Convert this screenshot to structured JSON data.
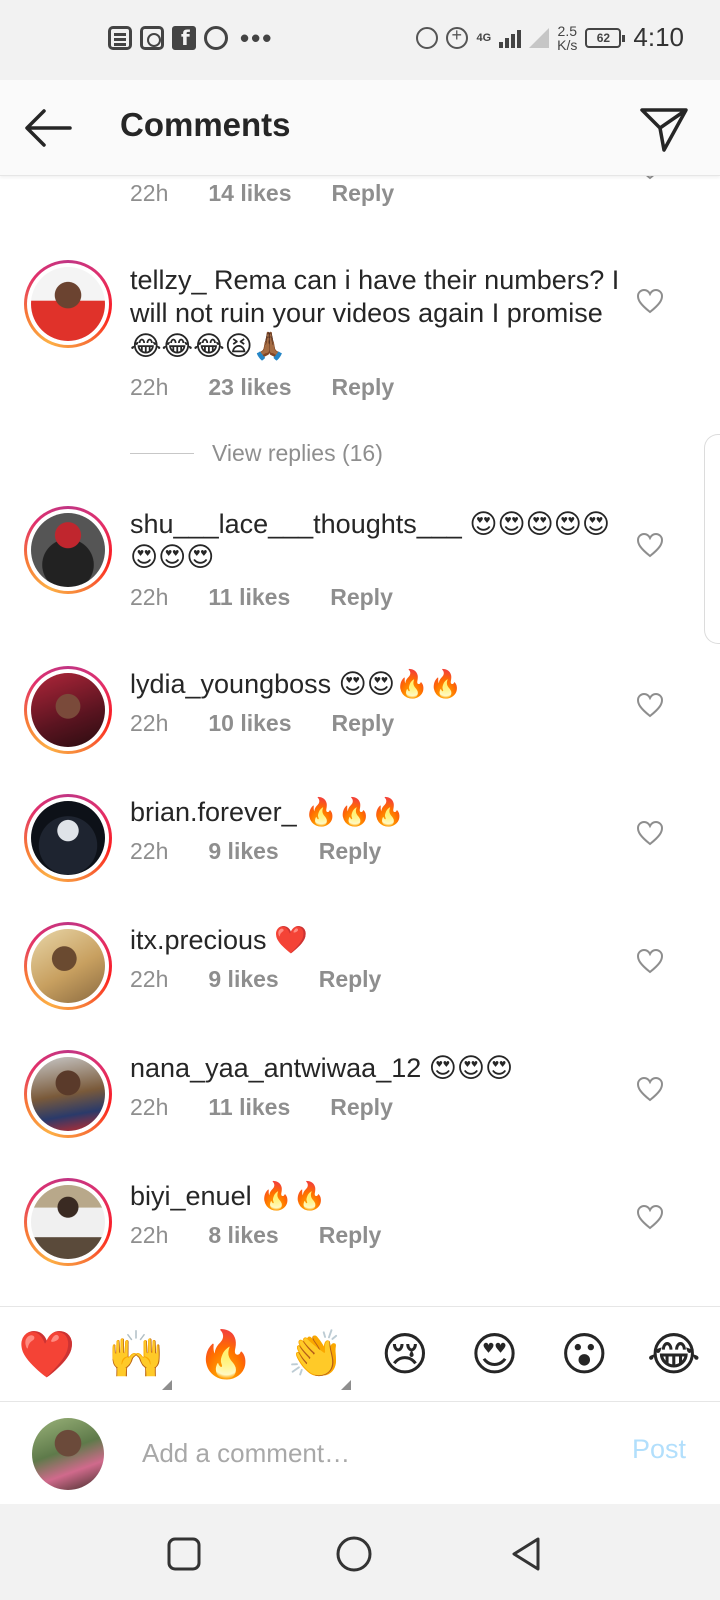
{
  "status_bar": {
    "net_type": "4G",
    "speed_value": "2.5",
    "speed_unit": "K/s",
    "battery": "62",
    "time": "4:10"
  },
  "header": {
    "title": "Comments",
    "back_icon": "arrow-left-icon",
    "send_icon": "paper-plane-icon"
  },
  "comments": [
    {
      "username": "",
      "text": "",
      "time": "22h",
      "likes": "14 likes",
      "reply": "Reply"
    },
    {
      "username": "tellzy_",
      "text": "Rema can i have their numbers? I will not ruin your videos again I promise 😂😂😂😫🙏🏾",
      "time": "22h",
      "likes": "23 likes",
      "reply": "Reply"
    },
    {
      "username": "shu___lace___thoughts___",
      "text": "😍😍😍😍😍😍😍😍",
      "time": "22h",
      "likes": "11 likes",
      "reply": "Reply"
    },
    {
      "username": "lydia_youngboss",
      "text": "😍😍🔥🔥",
      "time": "22h",
      "likes": "10 likes",
      "reply": "Reply"
    },
    {
      "username": "brian.forever_",
      "text": "🔥🔥🔥",
      "time": "22h",
      "likes": "9 likes",
      "reply": "Reply"
    },
    {
      "username": "itx.precious",
      "text": "❤️",
      "time": "22h",
      "likes": "9 likes",
      "reply": "Reply"
    },
    {
      "username": "nana_yaa_antwiwaa_12",
      "text": "😍😍😍",
      "time": "22h",
      "likes": "11 likes",
      "reply": "Reply"
    },
    {
      "username": "biyi_enuel",
      "text": "🔥🔥",
      "time": "22h",
      "likes": "8 likes",
      "reply": "Reply"
    }
  ],
  "view_replies": "View replies (16)",
  "quick_emojis": [
    "❤️",
    "🙌",
    "🔥",
    "👏",
    "😢",
    "😍",
    "😮",
    "😂"
  ],
  "composer": {
    "placeholder": "Add a comment…",
    "post_label": "Post"
  },
  "colors": {
    "accent_blue_disabled": "#b2dffc",
    "meta_gray": "#8e8e8e",
    "text": "#262626"
  }
}
